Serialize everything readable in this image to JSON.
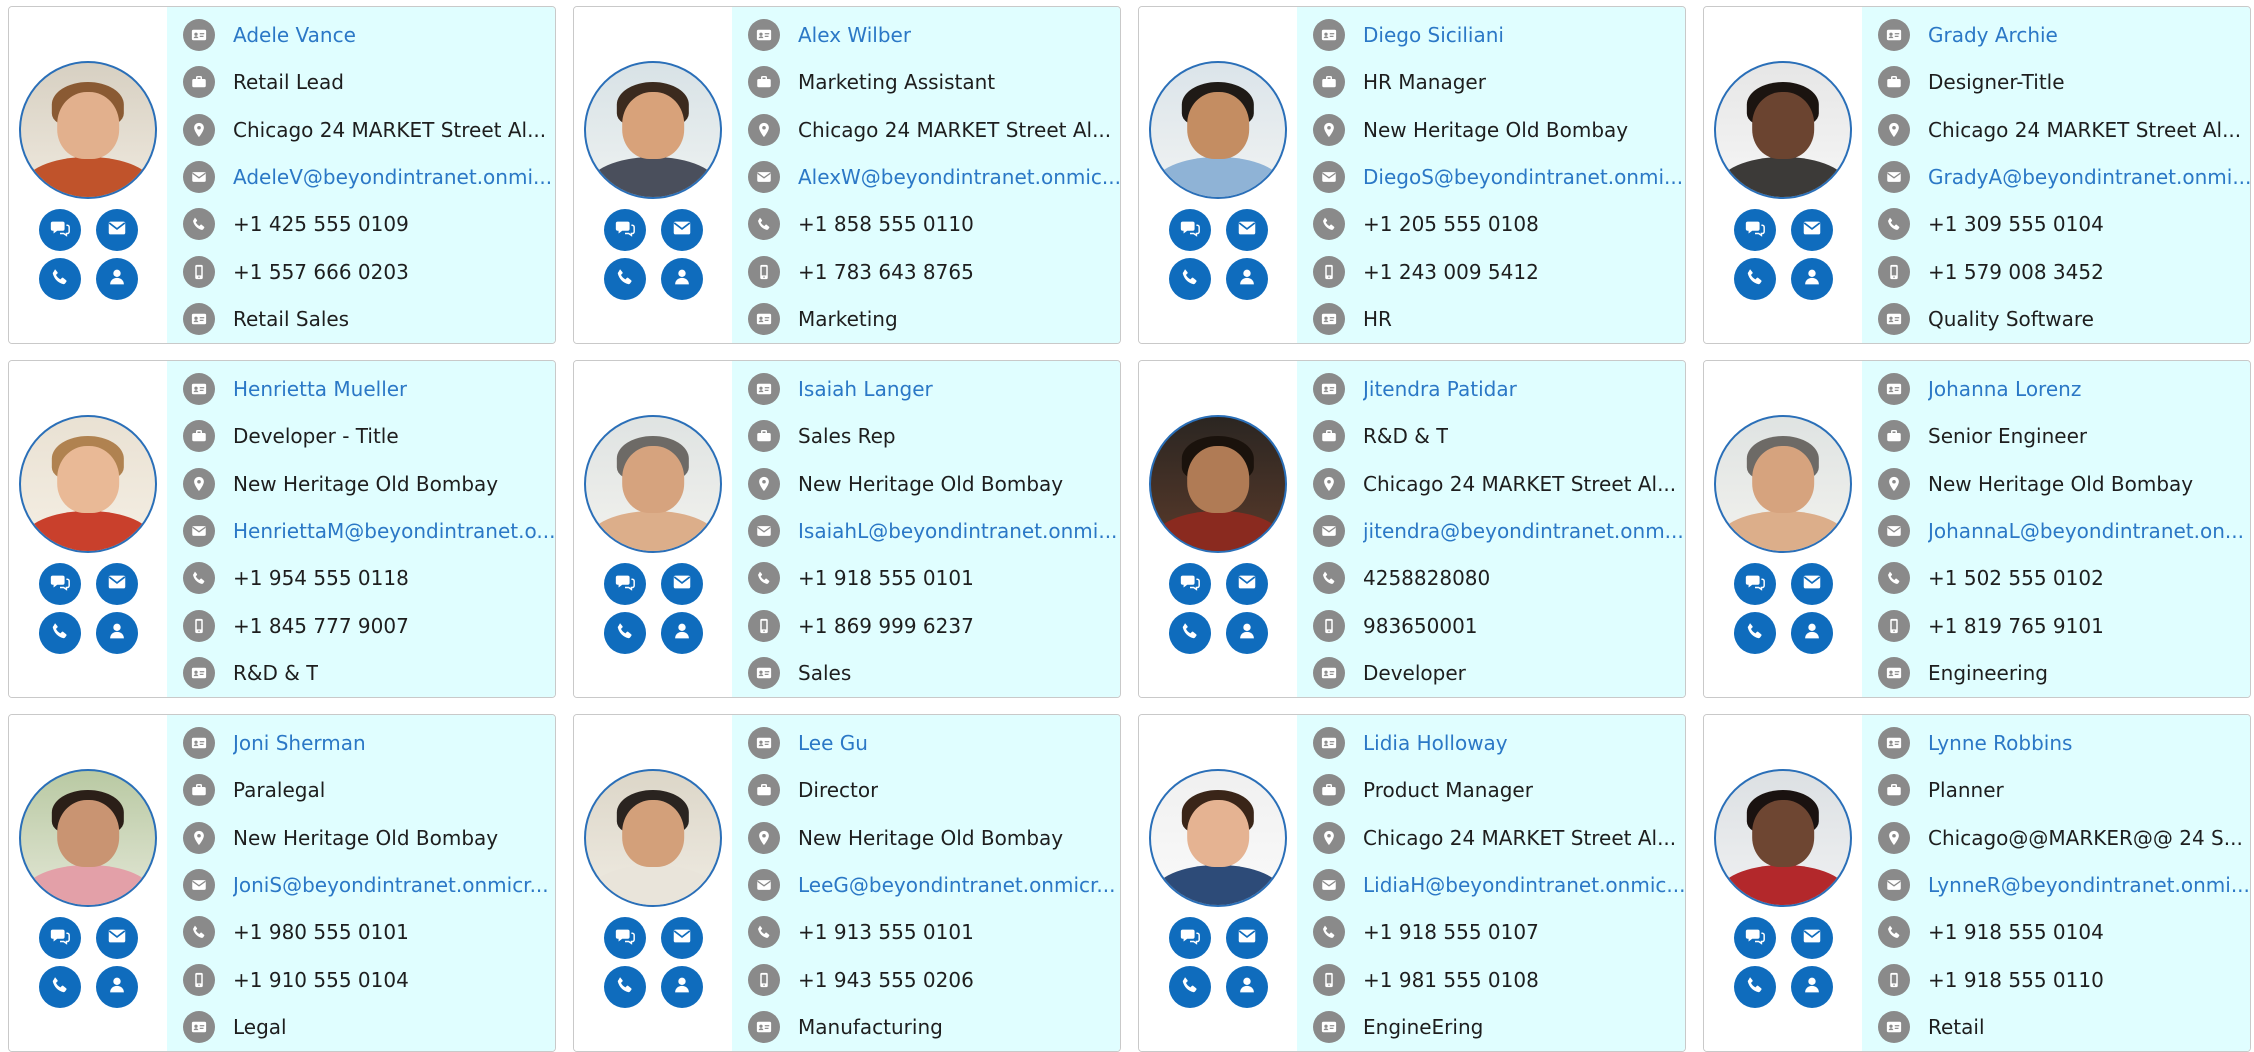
{
  "colors": {
    "accent": "#0f6cbd",
    "link": "#2b78c6",
    "info_bg": "#e0feff",
    "row_icon": "#8a8a8a"
  },
  "icons": {
    "name": "id-card-icon",
    "title": "briefcase-icon",
    "location": "map-pin-icon",
    "email": "mail-icon",
    "phone": "phone-icon",
    "mobile": "mobile-phone-icon",
    "department": "id-card-icon",
    "actions": [
      "chat-icon",
      "mail-icon",
      "call-icon",
      "profile-icon"
    ]
  },
  "people": [
    {
      "name": "Adele Vance",
      "title": "Retail Lead",
      "location": "Chicago 24 MARKET Street Al...",
      "email": "AdeleV@beyondintranet.onmi...",
      "phone": "+1 425 555 0109",
      "mobile": "+1 557 666 0203",
      "department": "Retail Sales",
      "avatar": {
        "skin": "#e2b08d",
        "hair": "#8a5a33",
        "shirt": "#c0532b",
        "bg1": "#d7d0c2",
        "bg2": "#efe9de"
      }
    },
    {
      "name": "Alex Wilber",
      "title": "Marketing Assistant",
      "location": "Chicago 24 MARKET Street Al...",
      "email": "AlexW@beyondintranet.onmic...",
      "phone": "+1 858 555 0110",
      "mobile": "+1 783 643 8765",
      "department": "Marketing",
      "avatar": {
        "skin": "#d8a27a",
        "hair": "#3b2a1e",
        "shirt": "#4a4f5c",
        "bg1": "#d8e2e6",
        "bg2": "#eef2f1"
      }
    },
    {
      "name": "Diego Siciliani",
      "title": "HR Manager",
      "location": "New Heritage Old Bombay",
      "email": "DiegoS@beyondintranet.onmi...",
      "phone": "+1 205 555 0108",
      "mobile": "+1 243 009 5412",
      "department": "HR",
      "avatar": {
        "skin": "#c48d62",
        "hair": "#1f1a16",
        "shirt": "#8fb3d6",
        "bg1": "#dbe4ea",
        "bg2": "#f1f3f2"
      }
    },
    {
      "name": "Grady Archie",
      "title": "Designer-Title",
      "location": "Chicago 24 MARKET Street Al...",
      "email": "GradyA@beyondintranet.onmi...",
      "phone": "+1 309 555 0104",
      "mobile": "+1 579 008 3452",
      "department": "Quality Software",
      "avatar": {
        "skin": "#6b4430",
        "hair": "#1b1410",
        "shirt": "#3c3a38",
        "bg1": "#e6e6e6",
        "bg2": "#f6f6f6"
      }
    },
    {
      "name": "Henrietta Mueller",
      "title": "Developer - Title",
      "location": "New Heritage Old Bombay",
      "email": "HenriettaM@beyondintranet.o...",
      "phone": "+1 954 555 0118",
      "mobile": "+1 845 777 9007",
      "department": "R&D & T",
      "avatar": {
        "skin": "#e9b996",
        "hair": "#b08250",
        "shirt": "#c9402c",
        "bg1": "#e9e1d3",
        "bg2": "#f5efe4"
      }
    },
    {
      "name": "Isaiah Langer",
      "title": "Sales Rep",
      "location": "New Heritage Old Bombay",
      "email": "IsaiahL@beyondintranet.onmi...",
      "phone": "+1 918 555 0101",
      "mobile": "+1 869 999 6237",
      "department": "Sales",
      "avatar": {
        "skin": "#d6a37e",
        "hair": "#6d6a66",
        "shirt": "#dcae8a",
        "bg1": "#dfe3e2",
        "bg2": "#f2f2ee"
      }
    },
    {
      "name": "Jitendra Patidar",
      "title": "R&D & T",
      "location": "Chicago 24 MARKET Street Al...",
      "email": "jitendra@beyondintranet.onm...",
      "phone": "4258828080",
      "mobile": "983650001",
      "department": "Developer",
      "avatar": {
        "skin": "#b07b55",
        "hair": "#1a120c",
        "shirt": "#8a2a1f",
        "bg1": "#2b2622",
        "bg2": "#5a3a2a"
      }
    },
    {
      "name": "Johanna Lorenz",
      "title": "Senior Engineer",
      "location": "New Heritage Old Bombay",
      "email": "JohannaL@beyondintranet.on...",
      "phone": "+1 502 555 0102",
      "mobile": "+1 819 765 9101",
      "department": "Engineering",
      "avatar": {
        "skin": "#d6a37e",
        "hair": "#6d6a66",
        "shirt": "#dcae8a",
        "bg1": "#dfe3e2",
        "bg2": "#f2f2ee"
      }
    },
    {
      "name": "Joni Sherman",
      "title": "Paralegal",
      "location": "New Heritage Old Bombay",
      "email": "JoniS@beyondintranet.onmicr...",
      "phone": "+1 980 555 0101",
      "mobile": "+1 910 555 0104",
      "department": "Legal",
      "avatar": {
        "skin": "#c99472",
        "hair": "#2b1f18",
        "shirt": "#e3a0a8",
        "bg1": "#b9c9a3",
        "bg2": "#e3e7d6"
      }
    },
    {
      "name": "Lee Gu",
      "title": "Director",
      "location": "New Heritage Old Bombay",
      "email": "LeeG@beyondintranet.onmicr...",
      "phone": "+1 913 555 0101",
      "mobile": "+1 943 555 0206",
      "department": "Manufacturing",
      "avatar": {
        "skin": "#d3a07a",
        "hair": "#2a2420",
        "shirt": "#e9e4da",
        "bg1": "#dcd6c8",
        "bg2": "#efebe2"
      }
    },
    {
      "name": "Lidia Holloway",
      "title": "Product Manager",
      "location": "Chicago 24 MARKET Street Al...",
      "email": "LidiaH@beyondintranet.onmic...",
      "phone": "+1 918 555 0107",
      "mobile": "+1 981 555 0108",
      "department": "EngineEring",
      "avatar": {
        "skin": "#e5b392",
        "hair": "#3a2518",
        "shirt": "#2d4b78",
        "bg1": "#f0f0f0",
        "bg2": "#fafafa"
      }
    },
    {
      "name": "Lynne Robbins",
      "title": "Planner",
      "location": "Chicago@@MARKER@@ 24 S...",
      "email": "LynneR@beyondintranet.onmi...",
      "phone": "+1 918 555 0104",
      "mobile": "+1 918 555 0110",
      "department": "Retail",
      "avatar": {
        "skin": "#6e4632",
        "hair": "#1a1210",
        "shirt": "#b3282b",
        "bg1": "#dce0e3",
        "bg2": "#f0f1f2"
      }
    }
  ]
}
